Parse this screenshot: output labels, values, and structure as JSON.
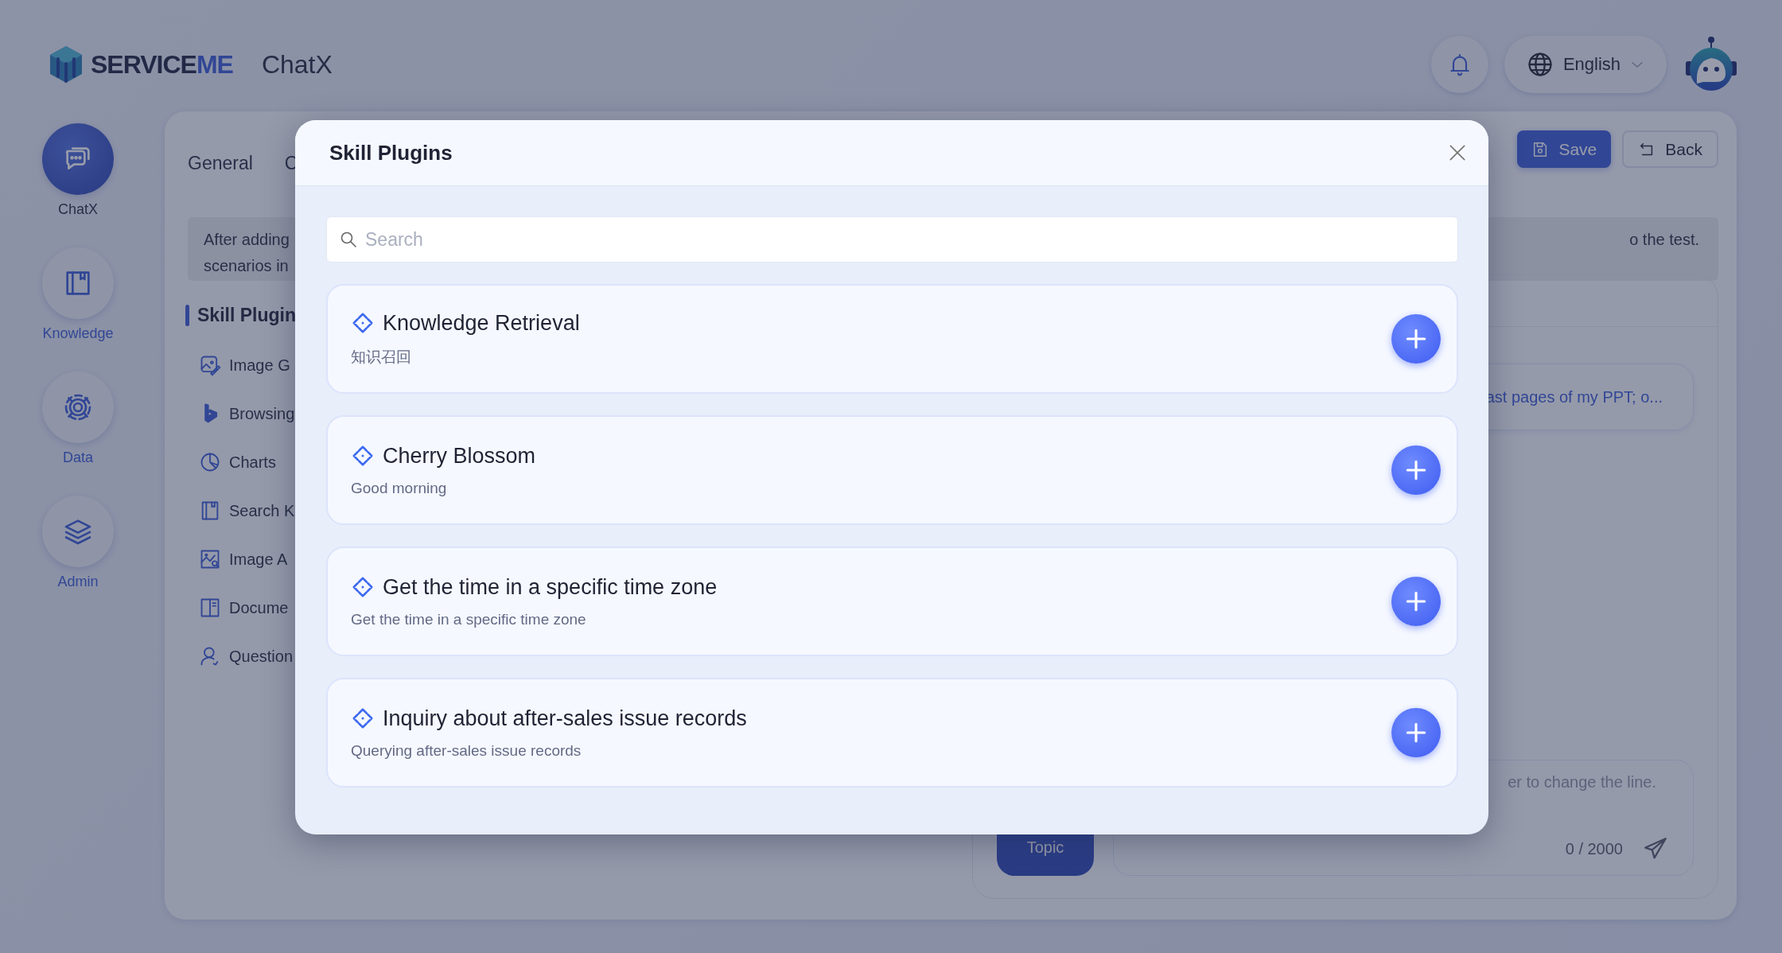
{
  "header": {
    "brand": {
      "main": "SERVICE",
      "accent": "ME"
    },
    "app_title": "ChatX",
    "language": "English"
  },
  "nav": [
    {
      "label": "ChatX",
      "selected": true
    },
    {
      "label": "Knowledge",
      "selected": false
    },
    {
      "label": "Data",
      "selected": false
    },
    {
      "label": "Admin",
      "selected": false
    }
  ],
  "editor": {
    "tabs": [
      "General",
      "C"
    ],
    "buttons": [
      {
        "label": "Save",
        "kind": "primary"
      },
      {
        "label": "Back",
        "kind": "default"
      }
    ],
    "notice": {
      "line_1": "After adding",
      "line_2": "scenarios in",
      "tail": "o the test."
    },
    "section_title": "Skill Plugin",
    "skills": [
      "Image G",
      "Browsing",
      "Charts",
      "Search K",
      "Image A",
      "Docume",
      "Question"
    ],
    "chat": {
      "suggestion": "ast pages of my PPT; o...",
      "new_topic": "Topic",
      "input_placeholder": "er to change the line.",
      "counter": "0 / 2000"
    }
  },
  "modal": {
    "title": "Skill Plugins",
    "search_placeholder": "Search",
    "plugins": [
      {
        "name": "Knowledge Retrieval",
        "description": "知识召回"
      },
      {
        "name": "Cherry Blossom",
        "description": "Good morning"
      },
      {
        "name": "Get the time in a specific time zone",
        "description": "Get the time in a specific time zone"
      },
      {
        "name": "Inquiry about after-sales issue records",
        "description": "Querying after-sales issue records"
      }
    ]
  }
}
